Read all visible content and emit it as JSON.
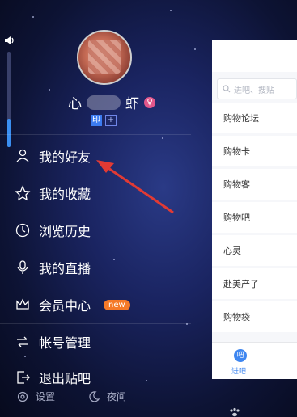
{
  "profile": {
    "username_left": "心",
    "username_right": "虾",
    "gender_symbol": "♀",
    "badge_1": "印",
    "badge_2": "+"
  },
  "menu": [
    {
      "label": "我的好友",
      "icon": "friends-icon"
    },
    {
      "label": "我的收藏",
      "icon": "star-icon"
    },
    {
      "label": "浏览历史",
      "icon": "clock-icon"
    },
    {
      "label": "我的直播",
      "icon": "microphone-icon"
    },
    {
      "label": "会员中心",
      "icon": "crown-icon",
      "tag": "new"
    },
    {
      "label": "帐号管理",
      "icon": "swap-icon"
    },
    {
      "label": "退出贴吧",
      "icon": "exit-icon"
    }
  ],
  "footer": {
    "settings_label": "设置",
    "night_label": "夜间"
  },
  "right_panel": {
    "search_placeholder": "进吧、搜贴",
    "items": [
      "购物论坛",
      "购物卡",
      "购物客",
      "购物吧",
      "心灵",
      "赴美产子",
      "购物袋"
    ],
    "tab_label": "进吧",
    "tab_icon_text": "吧"
  },
  "volume_level": 0.3,
  "colors": {
    "accent": "#3e86f0",
    "new_tag": "#f57a29",
    "arrow": "#e13a34"
  }
}
